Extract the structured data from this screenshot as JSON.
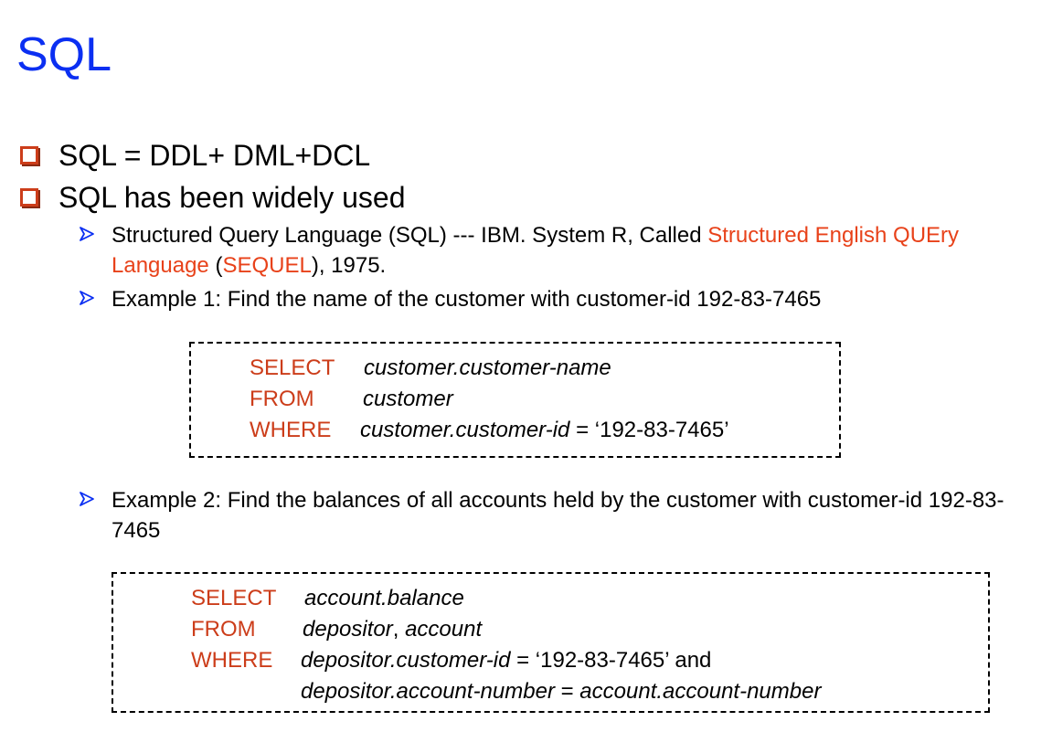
{
  "slide": {
    "title": "SQL",
    "bullets": [
      "SQL = DDL+ DML+DCL",
      "SQL has been widely used"
    ],
    "sub1": {
      "pre": "Structured Query Language (SQL) --- IBM. System R, Called ",
      "red1": "Structured English QUEry Language",
      "mid": " (",
      "red2": "SEQUEL",
      "post": "), 1975."
    },
    "sub2": "Example 1: Find the name of the customer with customer-id 192-83-7465",
    "sub3": "Example 2: Find the balances of all accounts held by the customer with customer-id 192-83-7465",
    "query1": {
      "select_kw": "SELECT",
      "select_val": "customer.customer-name",
      "from_kw": "FROM",
      "from_val": "customer",
      "where_kw": "WHERE",
      "where_val": "customer.customer-id",
      "where_rest": " = ‘192-83-7465’"
    },
    "query2": {
      "select_kw": "SELECT",
      "select_val": "account.balance",
      "from_kw": "FROM",
      "from_val1": "depositor",
      "from_sep": ", ",
      "from_val2": "account",
      "where_kw": "WHERE",
      "where_val": "depositor.customer-id",
      "where_rest": " = ‘192-83-7465’ and",
      "where2_a": "depositor.account-number",
      "where2_eq": " = ",
      "where2_b": "account.account-number"
    },
    "colors": {
      "title": "#0b2ff2",
      "highlight": "#e8421a",
      "keyword": "#cc3d1a",
      "bullet_icon": "#cc3d1a",
      "arrow_icon": "#0b2ff2"
    }
  }
}
